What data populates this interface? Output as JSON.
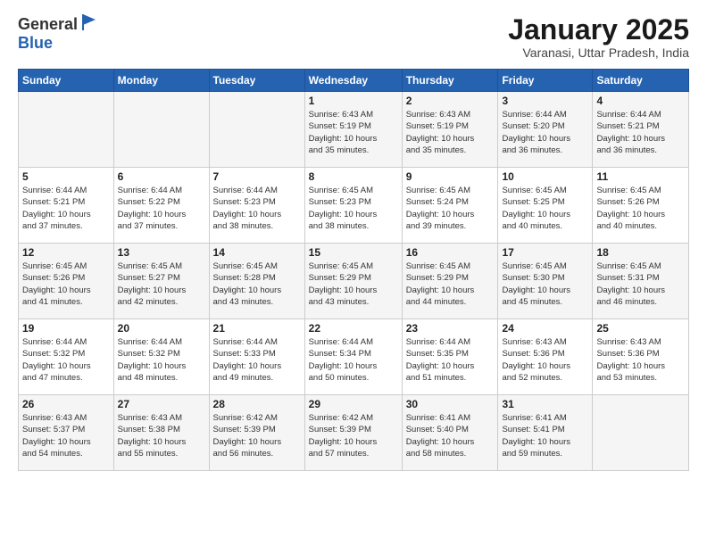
{
  "logo": {
    "general": "General",
    "blue": "Blue"
  },
  "header": {
    "month": "January 2025",
    "location": "Varanasi, Uttar Pradesh, India"
  },
  "days_of_week": [
    "Sunday",
    "Monday",
    "Tuesday",
    "Wednesday",
    "Thursday",
    "Friday",
    "Saturday"
  ],
  "weeks": [
    [
      {
        "num": "",
        "detail": ""
      },
      {
        "num": "",
        "detail": ""
      },
      {
        "num": "",
        "detail": ""
      },
      {
        "num": "1",
        "detail": "Sunrise: 6:43 AM\nSunset: 5:19 PM\nDaylight: 10 hours\nand 35 minutes."
      },
      {
        "num": "2",
        "detail": "Sunrise: 6:43 AM\nSunset: 5:19 PM\nDaylight: 10 hours\nand 35 minutes."
      },
      {
        "num": "3",
        "detail": "Sunrise: 6:44 AM\nSunset: 5:20 PM\nDaylight: 10 hours\nand 36 minutes."
      },
      {
        "num": "4",
        "detail": "Sunrise: 6:44 AM\nSunset: 5:21 PM\nDaylight: 10 hours\nand 36 minutes."
      }
    ],
    [
      {
        "num": "5",
        "detail": "Sunrise: 6:44 AM\nSunset: 5:21 PM\nDaylight: 10 hours\nand 37 minutes."
      },
      {
        "num": "6",
        "detail": "Sunrise: 6:44 AM\nSunset: 5:22 PM\nDaylight: 10 hours\nand 37 minutes."
      },
      {
        "num": "7",
        "detail": "Sunrise: 6:44 AM\nSunset: 5:23 PM\nDaylight: 10 hours\nand 38 minutes."
      },
      {
        "num": "8",
        "detail": "Sunrise: 6:45 AM\nSunset: 5:23 PM\nDaylight: 10 hours\nand 38 minutes."
      },
      {
        "num": "9",
        "detail": "Sunrise: 6:45 AM\nSunset: 5:24 PM\nDaylight: 10 hours\nand 39 minutes."
      },
      {
        "num": "10",
        "detail": "Sunrise: 6:45 AM\nSunset: 5:25 PM\nDaylight: 10 hours\nand 40 minutes."
      },
      {
        "num": "11",
        "detail": "Sunrise: 6:45 AM\nSunset: 5:26 PM\nDaylight: 10 hours\nand 40 minutes."
      }
    ],
    [
      {
        "num": "12",
        "detail": "Sunrise: 6:45 AM\nSunset: 5:26 PM\nDaylight: 10 hours\nand 41 minutes."
      },
      {
        "num": "13",
        "detail": "Sunrise: 6:45 AM\nSunset: 5:27 PM\nDaylight: 10 hours\nand 42 minutes."
      },
      {
        "num": "14",
        "detail": "Sunrise: 6:45 AM\nSunset: 5:28 PM\nDaylight: 10 hours\nand 43 minutes."
      },
      {
        "num": "15",
        "detail": "Sunrise: 6:45 AM\nSunset: 5:29 PM\nDaylight: 10 hours\nand 43 minutes."
      },
      {
        "num": "16",
        "detail": "Sunrise: 6:45 AM\nSunset: 5:29 PM\nDaylight: 10 hours\nand 44 minutes."
      },
      {
        "num": "17",
        "detail": "Sunrise: 6:45 AM\nSunset: 5:30 PM\nDaylight: 10 hours\nand 45 minutes."
      },
      {
        "num": "18",
        "detail": "Sunrise: 6:45 AM\nSunset: 5:31 PM\nDaylight: 10 hours\nand 46 minutes."
      }
    ],
    [
      {
        "num": "19",
        "detail": "Sunrise: 6:44 AM\nSunset: 5:32 PM\nDaylight: 10 hours\nand 47 minutes."
      },
      {
        "num": "20",
        "detail": "Sunrise: 6:44 AM\nSunset: 5:32 PM\nDaylight: 10 hours\nand 48 minutes."
      },
      {
        "num": "21",
        "detail": "Sunrise: 6:44 AM\nSunset: 5:33 PM\nDaylight: 10 hours\nand 49 minutes."
      },
      {
        "num": "22",
        "detail": "Sunrise: 6:44 AM\nSunset: 5:34 PM\nDaylight: 10 hours\nand 50 minutes."
      },
      {
        "num": "23",
        "detail": "Sunrise: 6:44 AM\nSunset: 5:35 PM\nDaylight: 10 hours\nand 51 minutes."
      },
      {
        "num": "24",
        "detail": "Sunrise: 6:43 AM\nSunset: 5:36 PM\nDaylight: 10 hours\nand 52 minutes."
      },
      {
        "num": "25",
        "detail": "Sunrise: 6:43 AM\nSunset: 5:36 PM\nDaylight: 10 hours\nand 53 minutes."
      }
    ],
    [
      {
        "num": "26",
        "detail": "Sunrise: 6:43 AM\nSunset: 5:37 PM\nDaylight: 10 hours\nand 54 minutes."
      },
      {
        "num": "27",
        "detail": "Sunrise: 6:43 AM\nSunset: 5:38 PM\nDaylight: 10 hours\nand 55 minutes."
      },
      {
        "num": "28",
        "detail": "Sunrise: 6:42 AM\nSunset: 5:39 PM\nDaylight: 10 hours\nand 56 minutes."
      },
      {
        "num": "29",
        "detail": "Sunrise: 6:42 AM\nSunset: 5:39 PM\nDaylight: 10 hours\nand 57 minutes."
      },
      {
        "num": "30",
        "detail": "Sunrise: 6:41 AM\nSunset: 5:40 PM\nDaylight: 10 hours\nand 58 minutes."
      },
      {
        "num": "31",
        "detail": "Sunrise: 6:41 AM\nSunset: 5:41 PM\nDaylight: 10 hours\nand 59 minutes."
      },
      {
        "num": "",
        "detail": ""
      }
    ]
  ]
}
